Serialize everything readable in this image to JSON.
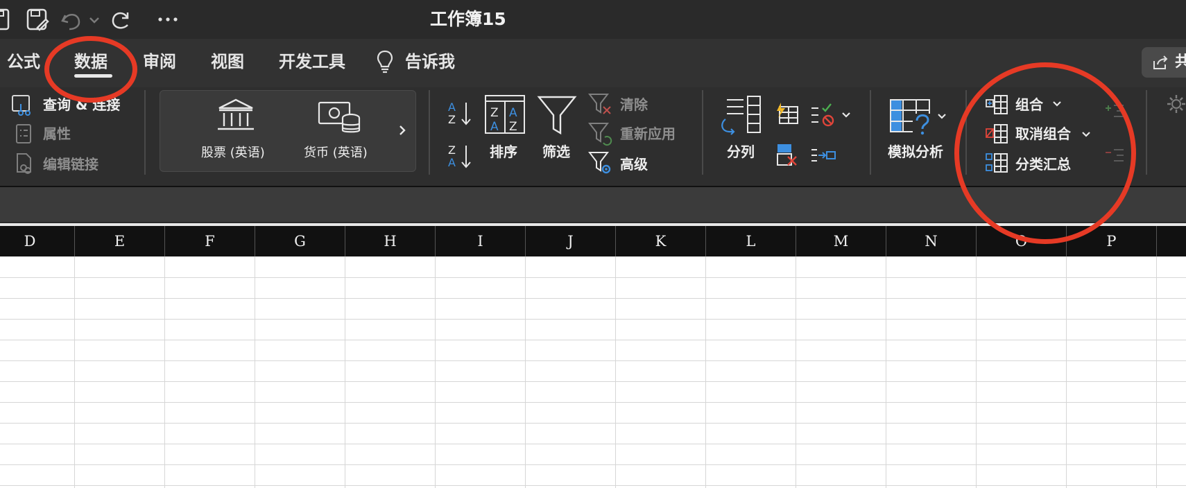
{
  "window": {
    "title": "工作簿15"
  },
  "quick_access": {
    "icons": [
      "file-icon",
      "save-icon",
      "undo-icon",
      "chevron-down-icon",
      "redo-icon",
      "more-icon"
    ]
  },
  "tabs": [
    {
      "label": "公式",
      "active": false
    },
    {
      "label": "数据",
      "active": true
    },
    {
      "label": "审阅",
      "active": false
    },
    {
      "label": "视图",
      "active": false
    },
    {
      "label": "开发工具",
      "active": false
    },
    {
      "label": "告诉我",
      "active": false,
      "icon": "lightbulb-icon"
    }
  ],
  "share": {
    "icon": "share-icon",
    "label": "共"
  },
  "ribbon": {
    "queries": {
      "items": [
        {
          "label": "查询 & 连接",
          "enabled": true,
          "icon": "queries-icon"
        },
        {
          "label": "属性",
          "enabled": false,
          "icon": "properties-icon"
        },
        {
          "label": "编辑链接",
          "enabled": false,
          "icon": "edit-links-icon"
        }
      ]
    },
    "data_types": {
      "items": [
        {
          "label": "股票 (英语)",
          "icon": "stocks-icon"
        },
        {
          "label": "货币 (英语)",
          "icon": "currency-icon"
        }
      ],
      "more_icon": "chevron-right-icon"
    },
    "sort_filter": {
      "sort_asc_icon": "sort-a-z-icon",
      "sort_desc_icon": "sort-z-a-icon",
      "sort_label": "排序",
      "filter_label": "筛选",
      "clear_label": "清除",
      "reapply_label": "重新应用",
      "advanced_label": "高级"
    },
    "data_tools": {
      "text_to_columns_label": "分列",
      "icons": [
        "flash-fill-icon",
        "data-validation-icon",
        "remove-duplicates-icon",
        "consolidate-icon"
      ]
    },
    "forecast": {
      "label": "模拟分析"
    },
    "outline": {
      "group_label": "组合",
      "ungroup_label": "取消组合",
      "subtotal_label": "分类汇总",
      "show_detail_icon": "show-detail-icon",
      "hide_detail_icon": "hide-detail-icon"
    },
    "analysis": {
      "icon": "gear-icon"
    }
  },
  "columns": [
    "D",
    "E",
    "F",
    "G",
    "H",
    "I",
    "J",
    "K",
    "L",
    "M",
    "N",
    "O",
    "P"
  ],
  "colors": {
    "titlebar": "#2a2a2a",
    "ribbon": "#2e2e2e",
    "accent_blue": "#3d8fe0",
    "annotation_red": "#e63a25"
  }
}
